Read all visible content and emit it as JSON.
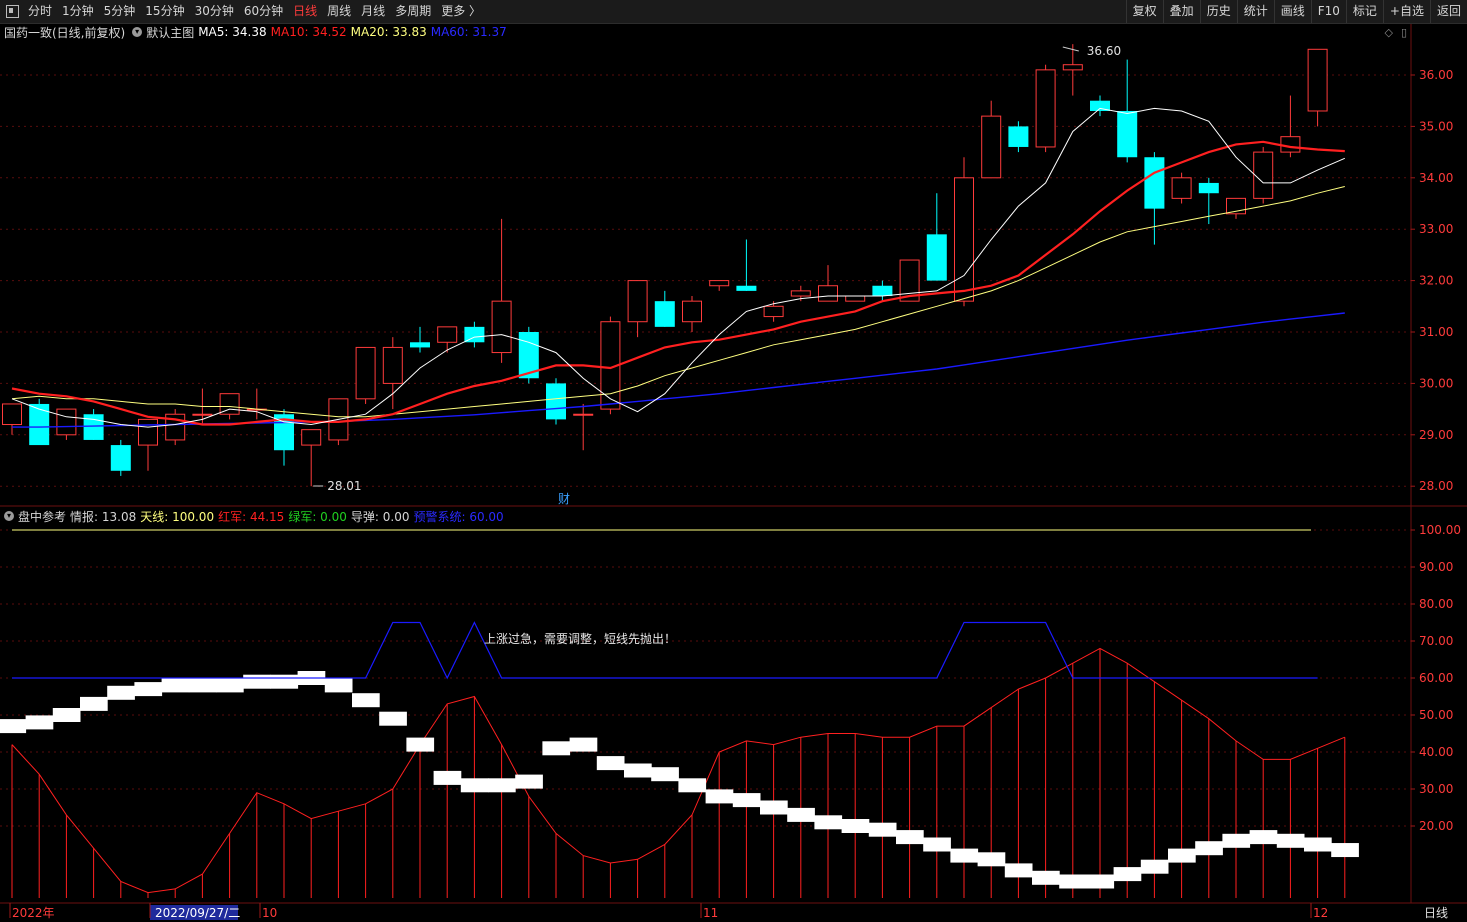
{
  "toolbar": {
    "periods": [
      "分时",
      "1分钟",
      "5分钟",
      "15分钟",
      "30分钟",
      "60分钟",
      "日线",
      "周线",
      "月线",
      "多周期",
      "更多 〉"
    ],
    "active_period": "日线",
    "tools": [
      "复权",
      "叠加",
      "历史",
      "统计",
      "画线",
      "F10",
      "标记",
      "+自选",
      "返回"
    ]
  },
  "main_pane": {
    "title": "国药一致(日线,前复权)",
    "template": "默认主图",
    "ma5_label": "MA5: 34.38",
    "ma10_label": "MA10: 34.52",
    "ma20_label": "MA20: 33.83",
    "ma60_label": "MA60: 31.37",
    "high_label": "36.60",
    "low_label": "28.01",
    "cai_label": "财",
    "y_ticks": [
      "36.00",
      "35.00",
      "34.00",
      "33.00",
      "32.00",
      "31.00",
      "30.00",
      "29.00",
      "28.00"
    ]
  },
  "sub_pane": {
    "title": "盘中参考",
    "qingbao": "情报: 13.08",
    "tianxian": "天线: 100.00",
    "hongjun": "红军: 44.15",
    "lvjun": "绿军: 0.00",
    "daodan": "导弹: 0.00",
    "yujing": "预警系统: 60.00",
    "annotation": "上涨过急，需要调整，短线先抛出！",
    "y_ticks": [
      "100.00",
      "90.00",
      "80.00",
      "70.00",
      "60.00",
      "50.00",
      "40.00",
      "30.00",
      "20.00"
    ]
  },
  "x_axis": {
    "labels": [
      "2022年",
      "2022/09/27/二",
      "10",
      "11",
      "12"
    ],
    "period_label": "日线"
  },
  "colors": {
    "up": "#ff3b3b",
    "down": "#00ffff",
    "ma5": "#ffffff",
    "ma10": "#ff2020",
    "ma20": "#ffff80",
    "ma60": "#1a1aff",
    "tianxian": "#ffff80",
    "hongjun": "#ff2020",
    "yujing": "#1a1aff",
    "axis_text": "#ff3b3b"
  },
  "chart_data": [
    {
      "type": "candlestick",
      "title": "国药一致(日线,前复权)",
      "ylim": [
        27.7,
        36.9
      ],
      "ohlc": [
        [
          29.2,
          29.5,
          29.0,
          29.6
        ],
        [
          29.6,
          29.7,
          29.2,
          28.8
        ],
        [
          29.0,
          29.5,
          28.9,
          29.5
        ],
        [
          29.4,
          29.5,
          28.9,
          28.9
        ],
        [
          28.8,
          28.9,
          28.2,
          28.3
        ],
        [
          28.8,
          29.3,
          28.3,
          29.3
        ],
        [
          28.9,
          29.5,
          28.8,
          29.4
        ],
        [
          29.4,
          29.9,
          29.2,
          29.4
        ],
        [
          29.4,
          29.8,
          29.3,
          29.8
        ],
        [
          29.5,
          29.9,
          29.3,
          29.5
        ],
        [
          29.4,
          29.5,
          28.4,
          28.7
        ],
        [
          28.8,
          29.1,
          28.0,
          29.1
        ],
        [
          28.9,
          29.7,
          28.8,
          29.7
        ],
        [
          29.7,
          30.7,
          29.6,
          30.7
        ],
        [
          30.0,
          30.9,
          29.5,
          30.7
        ],
        [
          30.8,
          31.1,
          30.6,
          30.7
        ],
        [
          30.8,
          31.1,
          30.6,
          31.1
        ],
        [
          31.1,
          31.2,
          30.7,
          30.8
        ],
        [
          30.6,
          33.2,
          30.4,
          31.6
        ],
        [
          31.0,
          31.1,
          30.0,
          30.1
        ],
        [
          30.0,
          30.1,
          29.2,
          29.3
        ],
        [
          29.4,
          29.6,
          28.7,
          29.4
        ],
        [
          29.5,
          31.3,
          29.4,
          31.2
        ],
        [
          31.2,
          32.0,
          30.9,
          32.0
        ],
        [
          31.6,
          31.8,
          31.1,
          31.1
        ],
        [
          31.2,
          31.7,
          31.0,
          31.6
        ],
        [
          31.9,
          32.0,
          31.8,
          32.0
        ],
        [
          31.9,
          32.8,
          31.8,
          31.8
        ],
        [
          31.3,
          31.6,
          31.2,
          31.5
        ],
        [
          31.7,
          31.9,
          31.6,
          31.8
        ],
        [
          31.6,
          32.3,
          31.6,
          31.9
        ],
        [
          31.6,
          31.7,
          31.6,
          31.7
        ],
        [
          31.9,
          32.0,
          31.6,
          31.7
        ],
        [
          31.6,
          32.4,
          31.6,
          32.4
        ],
        [
          32.9,
          33.7,
          32.8,
          32.0
        ],
        [
          31.6,
          34.4,
          31.5,
          34.0
        ],
        [
          34.0,
          35.5,
          34.0,
          35.2
        ],
        [
          35.0,
          35.1,
          34.5,
          34.6
        ],
        [
          34.6,
          36.2,
          34.5,
          36.1
        ],
        [
          36.1,
          36.6,
          35.6,
          36.2
        ],
        [
          35.5,
          35.6,
          35.2,
          35.3
        ],
        [
          35.3,
          36.3,
          34.3,
          34.4
        ],
        [
          34.4,
          34.5,
          32.7,
          33.4
        ],
        [
          33.6,
          34.1,
          33.5,
          34.0
        ],
        [
          33.9,
          34.0,
          33.1,
          33.7
        ],
        [
          33.3,
          33.5,
          33.2,
          33.6
        ],
        [
          33.6,
          34.6,
          33.5,
          34.5
        ],
        [
          34.5,
          35.6,
          34.4,
          34.8
        ],
        [
          35.3,
          35.6,
          35.0,
          36.5
        ]
      ],
      "ma5": [
        29.7,
        29.5,
        29.35,
        29.3,
        29.2,
        29.15,
        29.2,
        29.3,
        29.5,
        29.45,
        29.25,
        29.2,
        29.3,
        29.4,
        29.8,
        30.3,
        30.65,
        30.9,
        30.95,
        30.8,
        30.6,
        30.1,
        29.7,
        29.45,
        29.8,
        30.4,
        30.95,
        31.4,
        31.55,
        31.65,
        31.7,
        31.7,
        31.7,
        31.75,
        31.8,
        32.1,
        32.8,
        33.45,
        33.9,
        34.9,
        35.35,
        35.25,
        35.35,
        35.3,
        35.1,
        34.4,
        33.9,
        33.9,
        34.15,
        34.38
      ],
      "ma10": [
        29.9,
        29.8,
        29.75,
        29.65,
        29.5,
        29.35,
        29.3,
        29.2,
        29.2,
        29.25,
        29.3,
        29.25,
        29.25,
        29.3,
        29.4,
        29.6,
        29.8,
        29.95,
        30.05,
        30.2,
        30.35,
        30.35,
        30.3,
        30.5,
        30.7,
        30.8,
        30.85,
        30.95,
        31.05,
        31.2,
        31.3,
        31.4,
        31.6,
        31.7,
        31.75,
        31.8,
        31.9,
        32.1,
        32.5,
        32.9,
        33.35,
        33.75,
        34.1,
        34.3,
        34.5,
        34.65,
        34.7,
        34.6,
        34.55,
        34.52
      ],
      "ma20": [
        29.7,
        29.75,
        29.7,
        29.7,
        29.65,
        29.6,
        29.6,
        29.55,
        29.55,
        29.5,
        29.45,
        29.4,
        29.35,
        29.35,
        29.4,
        29.45,
        29.5,
        29.55,
        29.6,
        29.65,
        29.7,
        29.75,
        29.8,
        29.95,
        30.15,
        30.3,
        30.45,
        30.6,
        30.75,
        30.85,
        30.95,
        31.05,
        31.2,
        31.35,
        31.5,
        31.65,
        31.8,
        32.0,
        32.25,
        32.5,
        32.75,
        32.95,
        33.05,
        33.15,
        33.25,
        33.35,
        33.45,
        33.55,
        33.7,
        33.83
      ],
      "ma60": [
        29.15,
        29.15,
        29.16,
        29.17,
        29.18,
        29.19,
        29.2,
        29.21,
        29.22,
        29.23,
        29.24,
        29.25,
        29.26,
        29.28,
        29.3,
        29.33,
        29.36,
        29.39,
        29.43,
        29.47,
        29.51,
        29.55,
        29.6,
        29.65,
        29.7,
        29.75,
        29.8,
        29.86,
        29.92,
        29.98,
        30.04,
        30.1,
        30.16,
        30.22,
        30.28,
        30.36,
        30.44,
        30.52,
        30.6,
        30.68,
        30.76,
        30.84,
        30.91,
        30.98,
        31.05,
        31.12,
        31.19,
        31.25,
        31.31,
        31.37
      ]
    },
    {
      "type": "line",
      "title": "盘中参考",
      "ylim": [
        0,
        108
      ],
      "tianxian": 100,
      "yujing": [
        60,
        60,
        60,
        60,
        60,
        60,
        60,
        60,
        60,
        60,
        60,
        60,
        60,
        60,
        75,
        75,
        60,
        75,
        60,
        60,
        60,
        60,
        60,
        60,
        60,
        60,
        60,
        60,
        60,
        60,
        60,
        60,
        60,
        60,
        60,
        75,
        75,
        75,
        75,
        60,
        60,
        60,
        60,
        60,
        60,
        60,
        60,
        60,
        60
      ],
      "hongjun": [
        42,
        34,
        23,
        14,
        5,
        2,
        3,
        7,
        18,
        29,
        26,
        22,
        24,
        26,
        30,
        42,
        53,
        55,
        42,
        28,
        18,
        12,
        10,
        11,
        15,
        23,
        40,
        43,
        42,
        44,
        45,
        45,
        44,
        44,
        47,
        47,
        52,
        57,
        60,
        64,
        68,
        64,
        59,
        54,
        49,
        43,
        38,
        38,
        41,
        44
      ],
      "band_center": [
        47,
        48,
        50,
        53,
        56,
        57,
        58,
        58,
        58,
        59,
        59,
        60,
        58,
        54,
        49,
        42,
        33,
        31,
        31,
        32,
        41,
        42,
        37,
        35,
        34,
        31,
        28,
        27,
        25,
        23,
        21,
        20,
        19,
        17,
        15,
        12,
        11,
        8,
        6,
        5,
        5,
        7,
        9,
        12,
        14,
        16,
        17,
        16,
        15,
        13.5
      ]
    }
  ]
}
